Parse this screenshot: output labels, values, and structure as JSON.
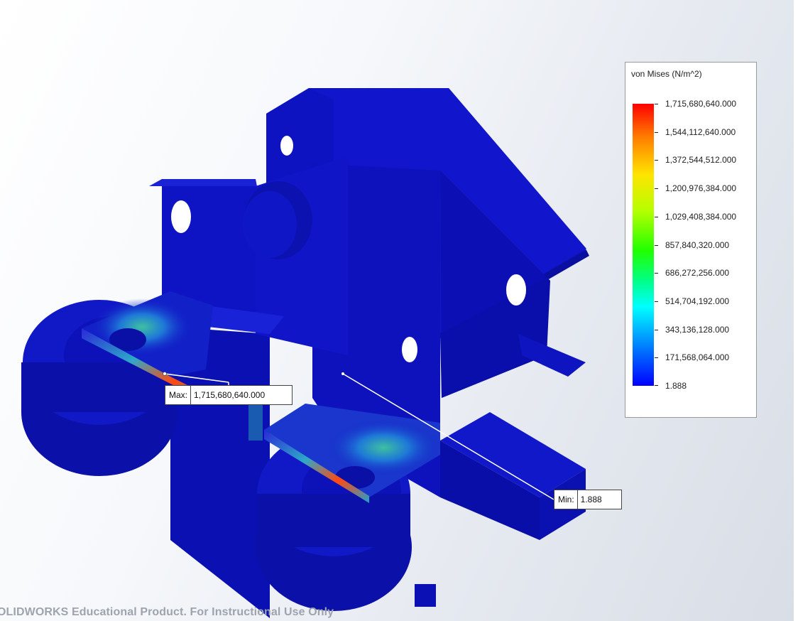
{
  "legend": {
    "title": "von Mises (N/m^2)",
    "ticks": [
      "1,715,680,640.000",
      "1,544,112,640.000",
      "1,372,544,512.000",
      "1,200,976,384.000",
      "1,029,408,384.000",
      "857,840,320.000",
      "686,272,256.000",
      "514,704,192.000",
      "343,136,128.000",
      "171,568,064.000",
      "1.888"
    ],
    "colormap": [
      "#ff0000",
      "#ff7f00",
      "#ffe400",
      "#b5ff00",
      "#22ff00",
      "#00ff8a",
      "#00ffff",
      "#0088ff",
      "#0000ff"
    ]
  },
  "max_callout": {
    "label": "Max:",
    "value": "1,715,680,640.000"
  },
  "min_callout": {
    "label": "Min:",
    "value": "1.888"
  },
  "watermark": "OLIDWORKS Educational Product. For Instructional Use Only",
  "colors": {
    "model_blue": "#0a12c4",
    "stress_hot": "#ff3300"
  }
}
